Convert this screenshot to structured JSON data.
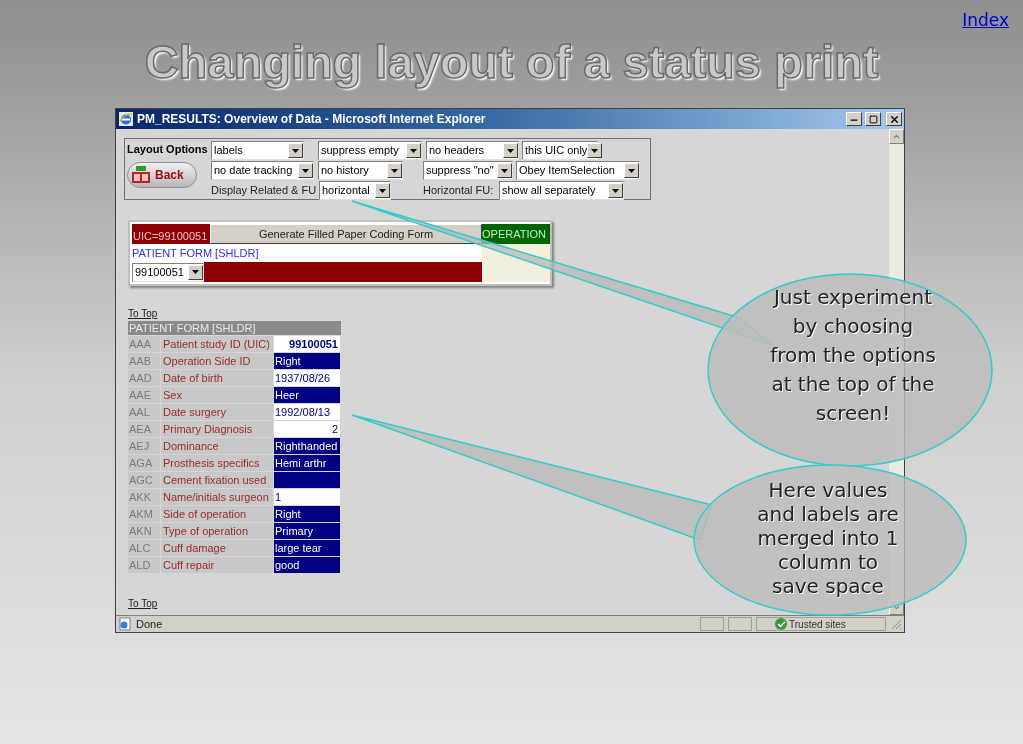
{
  "slide": {
    "index_link": "Index",
    "title": "Changing layout of a status print"
  },
  "window": {
    "title": "PM_RESULTS: Overview of Data - Microsoft Internet Explorer"
  },
  "layout_options": {
    "label": "Layout Options",
    "back_button": "Back",
    "rows": [
      [
        {
          "kind": "select",
          "value": "labels"
        },
        {
          "kind": "select",
          "value": "suppress empty"
        },
        {
          "kind": "select",
          "value": "no headers"
        },
        {
          "kind": "select",
          "value": "this UIC only"
        }
      ],
      [
        {
          "kind": "select",
          "value": "no date tracking"
        },
        {
          "kind": "select",
          "value": "no history"
        },
        {
          "kind": "select",
          "value": "suppress \"no\""
        },
        {
          "kind": "select",
          "value": "Obey ItemSelection"
        }
      ],
      [
        {
          "kind": "label",
          "value": "Display Related & FU"
        },
        {
          "kind": "select",
          "value": "horizontal"
        },
        {
          "kind": "label",
          "value": "Horizontal FU:"
        },
        {
          "kind": "select",
          "value": "show all separately"
        }
      ]
    ]
  },
  "form_panel": {
    "uic": "UIC=99100051",
    "generate_button": "Generate Filled Paper Coding Form",
    "operation": "OPERATION",
    "form_name": "PATIENT FORM [SHLDR]",
    "uic_select": "99100051"
  },
  "to_top_links": [
    "To Top",
    "To Top"
  ],
  "table": {
    "header": "PATIENT FORM [SHLDR]",
    "rows": [
      {
        "code": "AAA",
        "label": "Patient study ID (UIC)",
        "value": "99100051",
        "kind": "id"
      },
      {
        "code": "AAB",
        "label": "Operation Side ID",
        "value": "Right",
        "kind": "coded"
      },
      {
        "code": "AAD",
        "label": "Date of birth",
        "value": "1937/08/26",
        "kind": "text"
      },
      {
        "code": "AAE",
        "label": "Sex",
        "value": "Heer",
        "kind": "coded"
      },
      {
        "code": "AAL",
        "label": "Date surgery",
        "value": "1992/08/13",
        "kind": "text"
      },
      {
        "code": "AEA",
        "label": "Primary Diagnosis",
        "value": "2",
        "kind": "number"
      },
      {
        "code": "AEJ",
        "label": "Dominance",
        "value": "Righthanded",
        "kind": "coded"
      },
      {
        "code": "AGA",
        "label": "Prosthesis specifics",
        "value": "Hemi arthr",
        "kind": "coded"
      },
      {
        "code": "AGC",
        "label": "Cement fixation used",
        "kind": "coded"
      },
      {
        "code": "AKK",
        "label": "Name/initials surgeon",
        "value": "1",
        "kind": "text"
      },
      {
        "code": "AKM",
        "label": "Side of operation",
        "value": "Right",
        "kind": "coded"
      },
      {
        "code": "AKN",
        "label": "Type of operation",
        "value": "Primary",
        "kind": "coded"
      },
      {
        "code": "ALC",
        "label": "Cuff damage",
        "value": "large tear",
        "kind": "coded"
      },
      {
        "code": "ALD",
        "label": "Cuff repair",
        "value": "good",
        "kind": "coded"
      }
    ]
  },
  "status_bar": {
    "text": "Done",
    "zone": "Trusted sites"
  },
  "callouts": [
    {
      "text": "Just experiment\nby choosing\nfrom the options\nat the top of the\nscreen!"
    },
    {
      "text": "Here values\nand labels are\nmerged into 1\ncolumn to\nsave space"
    }
  ]
}
